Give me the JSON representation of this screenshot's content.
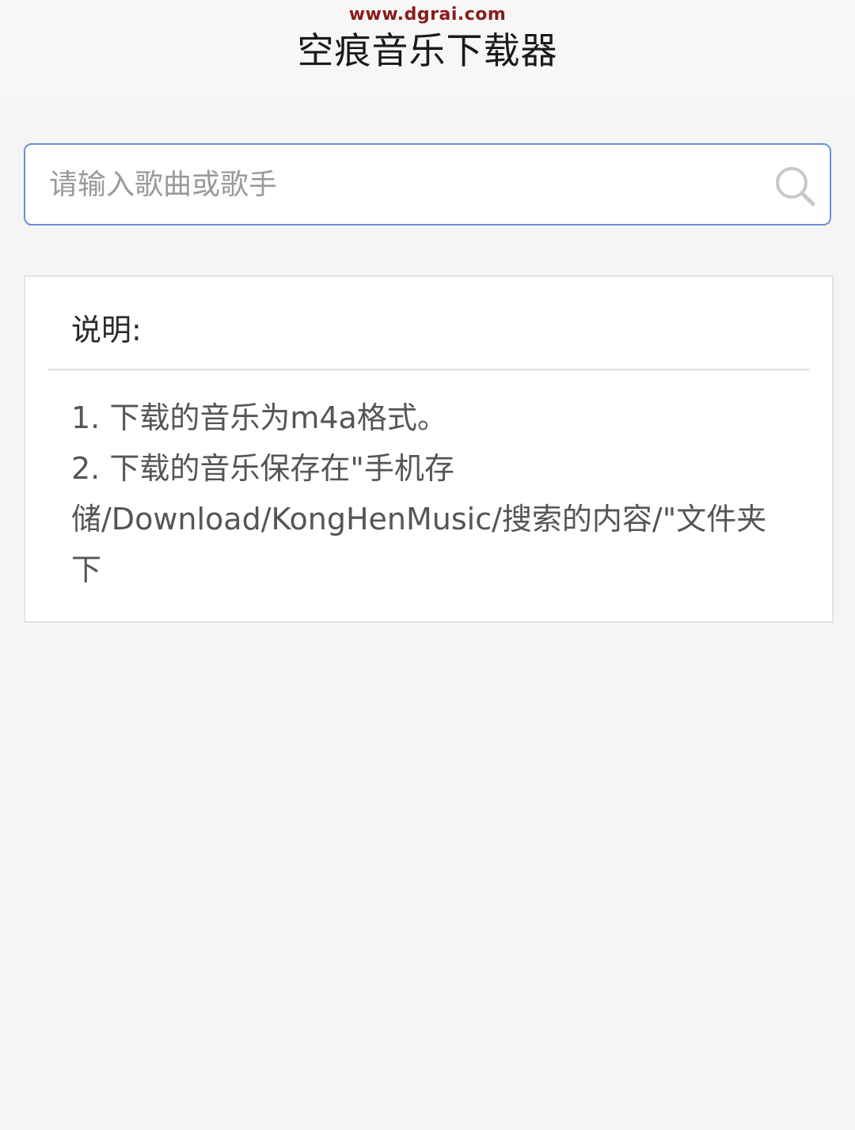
{
  "watermark": "www.dgrai.com",
  "header": {
    "title": "空痕音乐下载器"
  },
  "search": {
    "placeholder": "请输入歌曲或歌手",
    "value": "",
    "icon": "search-icon"
  },
  "info_card": {
    "title": "说明:",
    "items": [
      "1. 下载的音乐为m4a格式。",
      "2. 下载的音乐保存在\"手机存储/Download/KongHenMusic/搜索的内容/\"文件夹下"
    ]
  },
  "colors": {
    "accent_border": "#6b8fd3",
    "watermark": "#8b1a1a",
    "background": "#f5f5f5"
  }
}
